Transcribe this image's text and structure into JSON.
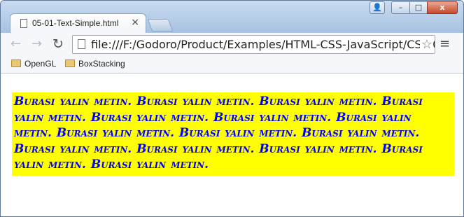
{
  "browser": {
    "tab": {
      "title": "05-01-Text-Simple.html",
      "close_glyph": "×"
    },
    "address_bar": {
      "url": "file:///F:/Godoro/Product/Examples/HTML-CSS-JavaScript/CSS/05-01-Text-Simple.html"
    },
    "toolbar": {
      "back_glyph": "←",
      "forward_glyph": "→",
      "reload_glyph": "↻",
      "star_glyph": "☆",
      "menu_glyph": "≡"
    },
    "window_controls": {
      "user_glyph": "👤",
      "minimize_glyph": "–",
      "maximize_glyph": "□",
      "close_glyph": "x"
    },
    "bookmarks": [
      {
        "label": "OpenGL",
        "icon": "folder-icon"
      },
      {
        "label": "BoxStacking",
        "icon": "folder-icon"
      }
    ]
  },
  "page": {
    "paragraph_text": "Burası yalın metin. Burası yalın metin. Burası yalın metin. Burası yalın metin. Burası yalın metin. Burası yalın metin. Burası yalın metin. Burası yalın metin. Burası yalın metin. Burası yalın metin. Burası yalın metin. Burası yalın metin. Burası yalın metin. Burası yalın metin. Burası yalın metin.",
    "text_color": "#0000ff",
    "background_color": "#ffff00"
  }
}
